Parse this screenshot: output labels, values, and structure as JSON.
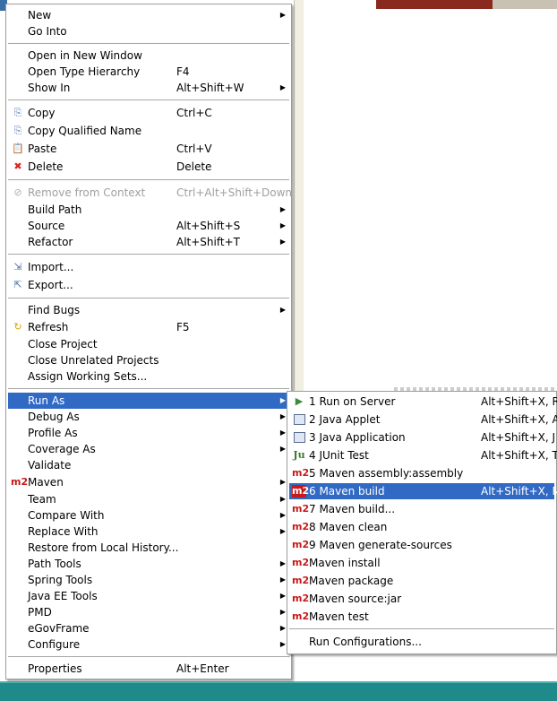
{
  "main_menu": {
    "items": [
      {
        "label": "New",
        "accel": "",
        "arrow": true
      },
      {
        "label": "Go Into",
        "accel": ""
      },
      {
        "label": "Open in New Window",
        "accel": ""
      },
      {
        "label": "Open Type Hierarchy",
        "accel": "F4"
      },
      {
        "label": "Show In",
        "accel": "Alt+Shift+W",
        "arrow": true
      },
      {
        "label": "Copy",
        "accel": "Ctrl+C",
        "icon": "copy-icon"
      },
      {
        "label": "Copy Qualified Name",
        "accel": "",
        "icon": "copy-qualified-icon"
      },
      {
        "label": "Paste",
        "accel": "Ctrl+V",
        "icon": "paste-icon"
      },
      {
        "label": "Delete",
        "accel": "Delete",
        "icon": "delete-icon"
      },
      {
        "label": "Remove from Context",
        "accel": "Ctrl+Alt+Shift+Down",
        "disabled": true,
        "icon": "remove-context-icon"
      },
      {
        "label": "Build Path",
        "accel": "",
        "arrow": true
      },
      {
        "label": "Source",
        "accel": "Alt+Shift+S",
        "arrow": true
      },
      {
        "label": "Refactor",
        "accel": "Alt+Shift+T",
        "arrow": true
      },
      {
        "label": "Import...",
        "accel": "",
        "icon": "import-icon"
      },
      {
        "label": "Export...",
        "accel": "",
        "icon": "export-icon"
      },
      {
        "label": "Find Bugs",
        "accel": "",
        "arrow": true
      },
      {
        "label": "Refresh",
        "accel": "F5",
        "icon": "refresh-icon"
      },
      {
        "label": "Close Project",
        "accel": ""
      },
      {
        "label": "Close Unrelated Projects",
        "accel": ""
      },
      {
        "label": "Assign Working Sets...",
        "accel": ""
      },
      {
        "label": "Run As",
        "accel": "",
        "arrow": true,
        "selected": true
      },
      {
        "label": "Debug As",
        "accel": "",
        "arrow": true
      },
      {
        "label": "Profile As",
        "accel": "",
        "arrow": true
      },
      {
        "label": "Coverage As",
        "accel": "",
        "arrow": true
      },
      {
        "label": "Validate",
        "accel": ""
      },
      {
        "label": "Maven",
        "accel": "",
        "arrow": true,
        "icon": "maven-icon"
      },
      {
        "label": "Team",
        "accel": "",
        "arrow": true
      },
      {
        "label": "Compare With",
        "accel": "",
        "arrow": true
      },
      {
        "label": "Replace With",
        "accel": "",
        "arrow": true
      },
      {
        "label": "Restore from Local History...",
        "accel": ""
      },
      {
        "label": "Path Tools",
        "accel": "",
        "arrow": true
      },
      {
        "label": "Spring Tools",
        "accel": "",
        "arrow": true
      },
      {
        "label": "Java EE Tools",
        "accel": "",
        "arrow": true
      },
      {
        "label": "PMD",
        "accel": "",
        "arrow": true
      },
      {
        "label": "eGovFrame",
        "accel": "",
        "arrow": true
      },
      {
        "label": "Configure",
        "accel": "",
        "arrow": true
      },
      {
        "label": "Properties",
        "accel": "Alt+Enter"
      }
    ]
  },
  "run_as_submenu": {
    "items": [
      {
        "label": "1 Run on Server",
        "accel": "Alt+Shift+X, R",
        "icon": "server-icon"
      },
      {
        "label": "2 Java Applet",
        "accel": "Alt+Shift+X, A",
        "icon": "applet-icon"
      },
      {
        "label": "3 Java Application",
        "accel": "Alt+Shift+X, J",
        "icon": "java-app-icon"
      },
      {
        "label": "4 JUnit Test",
        "accel": "Alt+Shift+X, T",
        "icon": "junit-icon"
      },
      {
        "label": "5 Maven assembly:assembly",
        "accel": "",
        "icon": "maven-icon"
      },
      {
        "label": "6 Maven build",
        "accel": "Alt+Shift+X, M",
        "icon": "maven-icon",
        "selected": true
      },
      {
        "label": "7 Maven build...",
        "accel": "",
        "icon": "maven-icon"
      },
      {
        "label": "8 Maven clean",
        "accel": "",
        "icon": "maven-icon"
      },
      {
        "label": "9 Maven generate-sources",
        "accel": "",
        "icon": "maven-icon"
      },
      {
        "label": "Maven install",
        "accel": "",
        "icon": "maven-icon"
      },
      {
        "label": "Maven package",
        "accel": "",
        "icon": "maven-icon"
      },
      {
        "label": "Maven source:jar",
        "accel": "",
        "icon": "maven-icon"
      },
      {
        "label": "Maven test",
        "accel": "",
        "icon": "maven-icon"
      },
      {
        "label": "Run Configurations...",
        "accel": ""
      }
    ]
  },
  "icons": {
    "m2": "m2",
    "ju": "Ju",
    "arrow": "▶",
    "delete": "✖",
    "copy": "⎘",
    "paste": "📋",
    "refresh": "↻",
    "import": "⇲",
    "export": "⇱",
    "server": "▶",
    "remove": "⊘"
  },
  "colors": {
    "selection": "#316ac5",
    "taskbar": "#1e8a8a",
    "maven_icon": "#c51a1a"
  }
}
